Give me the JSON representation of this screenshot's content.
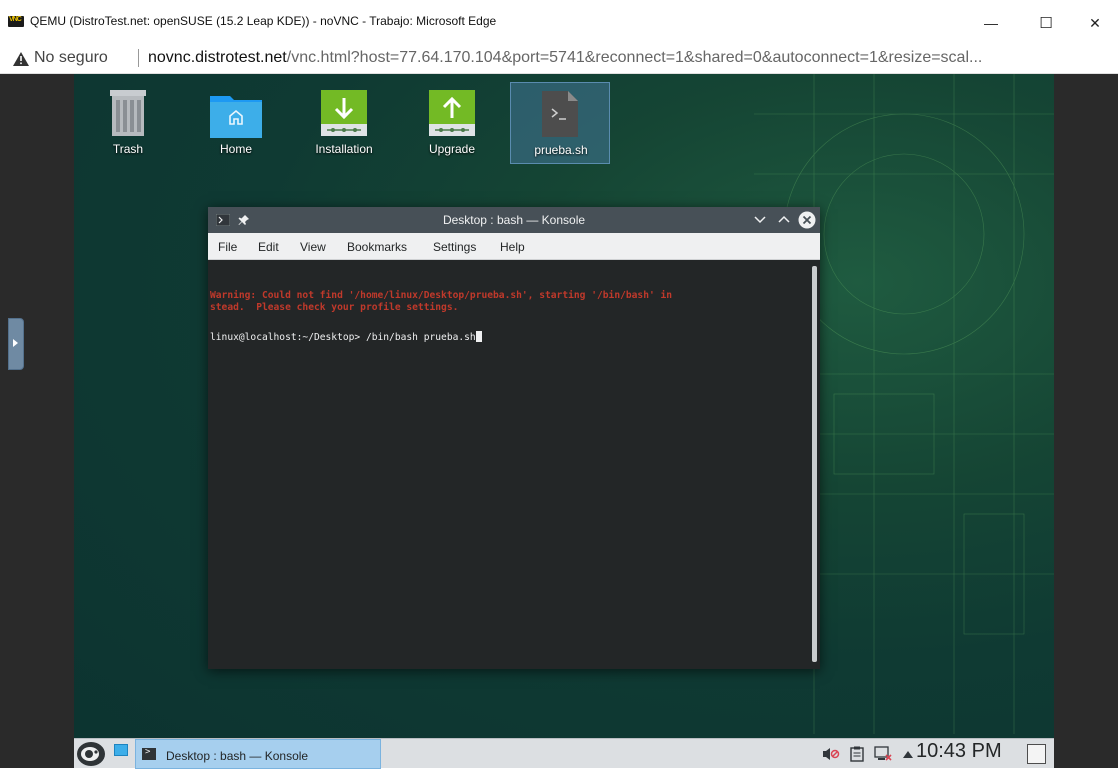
{
  "browser": {
    "window_title": "QEMU (DistroTest.net: openSUSE (15.2 Leap KDE)) - noVNC - Trabajo: Microsoft Edge",
    "app_icon_text": "VNC",
    "security_label": "No seguro",
    "url_host": "novnc.distrotest.net",
    "url_rest": "/vnc.html?host=77.64.170.104&port=5741&reconnect=1&shared=0&autoconnect=1&resize=scal...",
    "minimize_glyph": "—",
    "maximize_glyph": "☐",
    "close_glyph": "✕"
  },
  "desktop": {
    "icons": [
      {
        "label": "Trash",
        "icon": "trash-icon"
      },
      {
        "label": "Home",
        "icon": "home-folder-icon"
      },
      {
        "label": "Installation",
        "icon": "installation-icon"
      },
      {
        "label": "Upgrade",
        "icon": "upgrade-icon"
      },
      {
        "label": "prueba.sh",
        "icon": "script-file-icon",
        "selected": true
      }
    ]
  },
  "konsole": {
    "title": "Desktop : bash — Konsole",
    "menu": [
      "File",
      "Edit",
      "View",
      "Bookmarks",
      "Settings",
      "Help"
    ],
    "terminal": {
      "warning_line1": "Warning: Could not find '/home/linux/Desktop/prueba.sh', starting '/bin/bash' in",
      "warning_line2": "stead.  Please check your profile settings.",
      "prompt": "linux@localhost:~/Desktop> ",
      "command": "/bin/bash prueba.sh"
    }
  },
  "taskbar": {
    "task_label": "Desktop : bash — Konsole",
    "clock": "10:43 PM"
  },
  "colors": {
    "warning_text": "#c0392b",
    "konsole_bg": "#232627",
    "task_active": "#a6cfee",
    "desktop_green": "#154534"
  }
}
